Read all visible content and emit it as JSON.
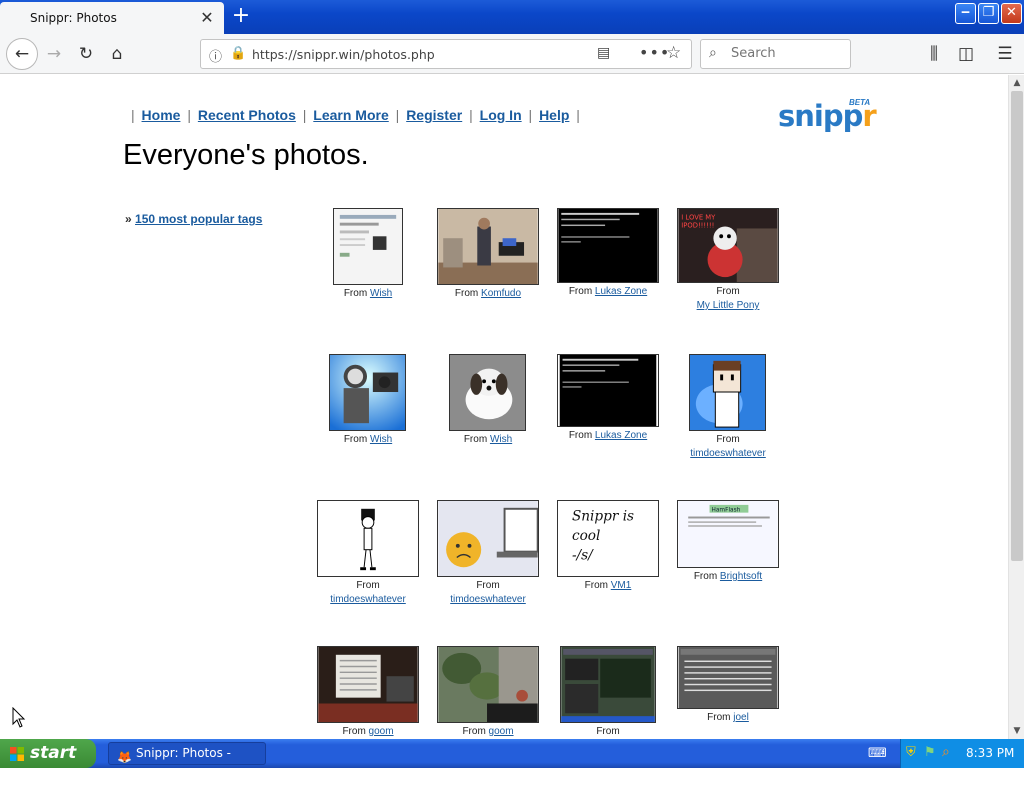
{
  "browser": {
    "tab_title": "Snippr: Photos",
    "tab_close": "✕",
    "new_tab": "+",
    "url": "https://snippr.win/photos.php",
    "search_placeholder": "Search"
  },
  "site": {
    "nav": [
      "Home",
      "Recent Photos",
      "Learn More",
      "Register",
      "Log In",
      "Help"
    ],
    "logo_main": "snipp",
    "logo_accent": "r",
    "logo_beta": "BETA",
    "page_title": "Everyone's photos.",
    "tags_prefix": "»",
    "tags_link": "150 most popular tags",
    "from_label": "From"
  },
  "photos": [
    {
      "source": "Wish",
      "thumb": "screenshot"
    },
    {
      "source": "Komfudo",
      "thumb": "room"
    },
    {
      "source": "Lukas Zone",
      "thumb": "terminal"
    },
    {
      "source": "My Little Pony",
      "thumb": "toy",
      "thumb_text": "I LOVE MY IPOD!!!!!!"
    },
    {
      "source": "Wish",
      "thumb": "astronaut"
    },
    {
      "source": "Wish",
      "thumb": "dog"
    },
    {
      "source": "Lukas Zone",
      "thumb": "terminal"
    },
    {
      "source": "timdoeswhatever",
      "thumb": "cartoon"
    },
    {
      "source": "timdoeswhatever",
      "thumb": "stickfigure"
    },
    {
      "source": "timdoeswhatever",
      "thumb": "smiley"
    },
    {
      "source": "VM1",
      "thumb": "handwriting",
      "thumb_text": "Snippr is cool -/s/"
    },
    {
      "source": "Brightsoft",
      "thumb": "webpage",
      "thumb_text": "HamFlash"
    },
    {
      "source": "goom",
      "thumb": "heater"
    },
    {
      "source": "goom",
      "thumb": "plants"
    },
    {
      "source": "",
      "thumb": "desktop"
    },
    {
      "source": "joel",
      "thumb": "table"
    }
  ],
  "taskbar": {
    "start": "start",
    "task": "Snippr: Photos - Mypal",
    "clock": "8:33 PM"
  }
}
